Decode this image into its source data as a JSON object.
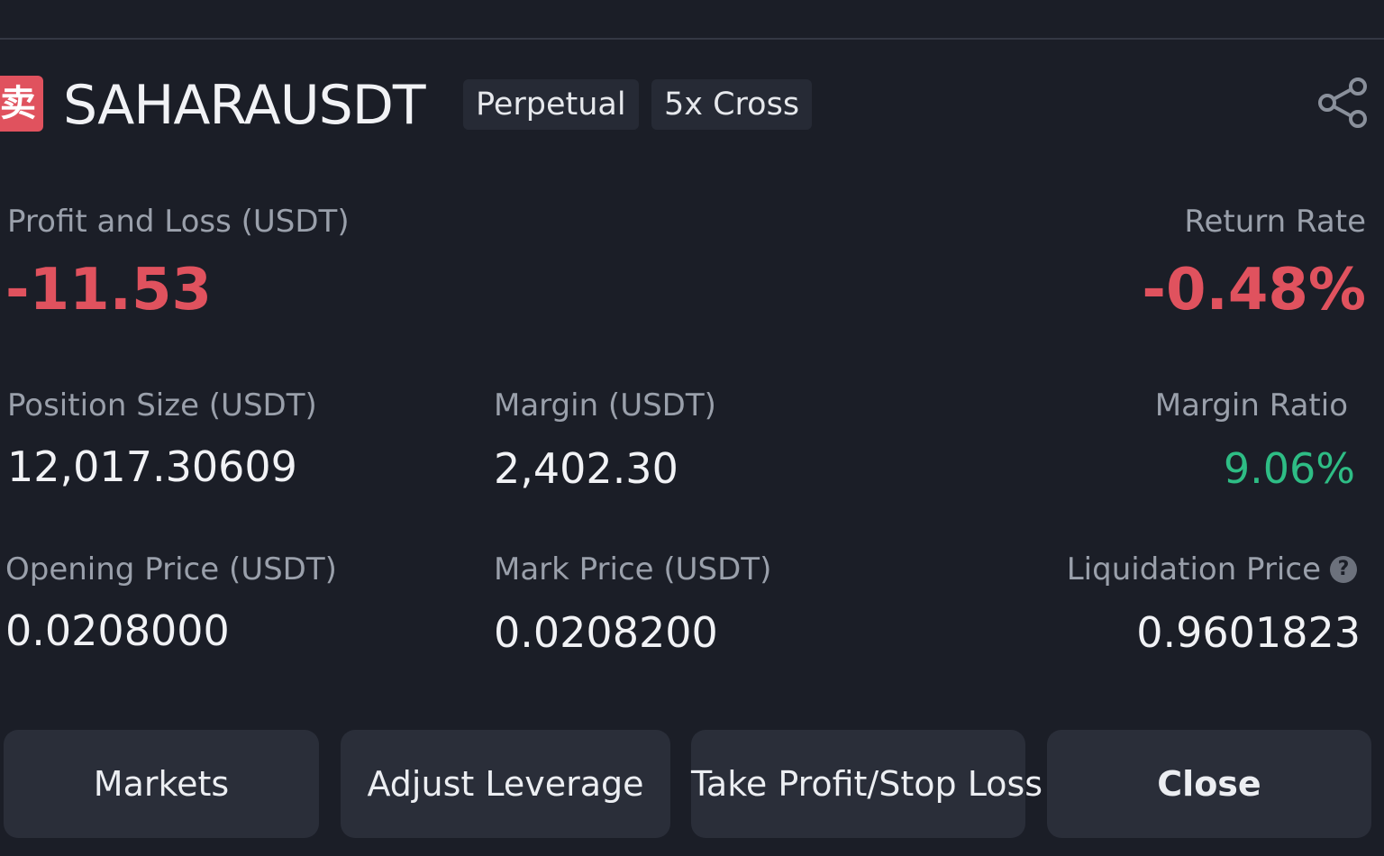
{
  "header": {
    "side_badge": "卖",
    "symbol": "SAHARAUSDT",
    "contract_type": "Perpetual",
    "leverage": "5x Cross",
    "share_icon": "share-icon"
  },
  "pnl": {
    "label": "Profit and Loss (USDT)",
    "value": "-11.53"
  },
  "return_rate": {
    "label": "Return Rate",
    "value": "-0.48%"
  },
  "position_size": {
    "label": "Position Size (USDT)",
    "value": "12,017.30609"
  },
  "margin": {
    "label": "Margin (USDT)",
    "value": "2,402.30"
  },
  "margin_ratio": {
    "label": "Margin Ratio",
    "value": "9.06%"
  },
  "opening_price": {
    "label": "Opening Price (USDT)",
    "value": "0.0208000"
  },
  "mark_price": {
    "label": "Mark Price (USDT)",
    "value": "0.0208200"
  },
  "liquidation_price": {
    "label": "Liquidation Price",
    "value": "0.9601823",
    "help_icon": "question-icon"
  },
  "actions": {
    "markets": "Markets",
    "adjust_leverage": "Adjust Leverage",
    "tp_sl": "Take Profit/Stop Loss",
    "close": "Close"
  },
  "colors": {
    "background": "#1b1e27",
    "negative": "#e0525e",
    "positive": "#2ebd85",
    "button": "#2a2e39"
  }
}
